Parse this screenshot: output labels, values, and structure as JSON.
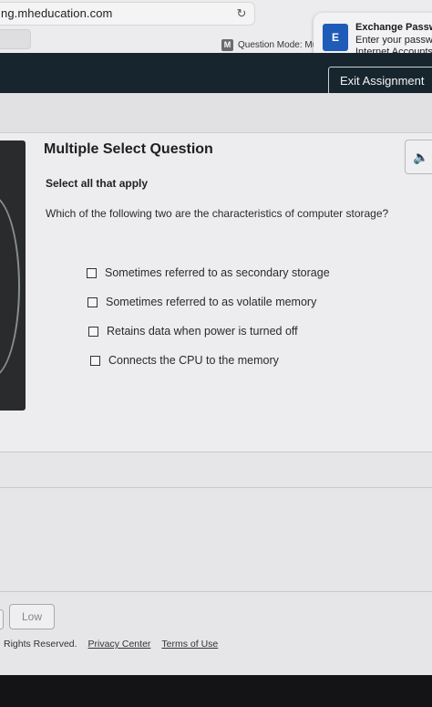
{
  "browser": {
    "url_text": "ng.mheducation.com",
    "reload_icon": "reload-icon"
  },
  "mode": {
    "badge": "M",
    "label": "Question Mode: Mu"
  },
  "notification": {
    "icon_label": "E",
    "title": "Exchange Passwo",
    "line1": "Enter your passwo",
    "line2": "Internet Accounts."
  },
  "header": {
    "exit_label": "Exit Assignment",
    "exit_icon": "×"
  },
  "question": {
    "title": "Multiple Select Question",
    "instruction": "Select all that apply",
    "prompt": "Which of the following two are the characteristics of computer storage?",
    "audio_icon": "🔈",
    "options": [
      {
        "label": "Sometimes referred to as secondary storage",
        "checked": false
      },
      {
        "label": "Sometimes referred to as volatile memory",
        "checked": false
      },
      {
        "label": "Retains data when power is turned off",
        "checked": false
      },
      {
        "label": "Connects the CPU to the memory",
        "checked": false
      }
    ]
  },
  "confidence": {
    "low_label": "Low"
  },
  "footer": {
    "rights": "Rights Reserved.",
    "privacy": "Privacy Center",
    "terms": "Terms of Use"
  },
  "colors": {
    "header_bg": "#17262e",
    "notification_icon": "#1f5cb8"
  }
}
